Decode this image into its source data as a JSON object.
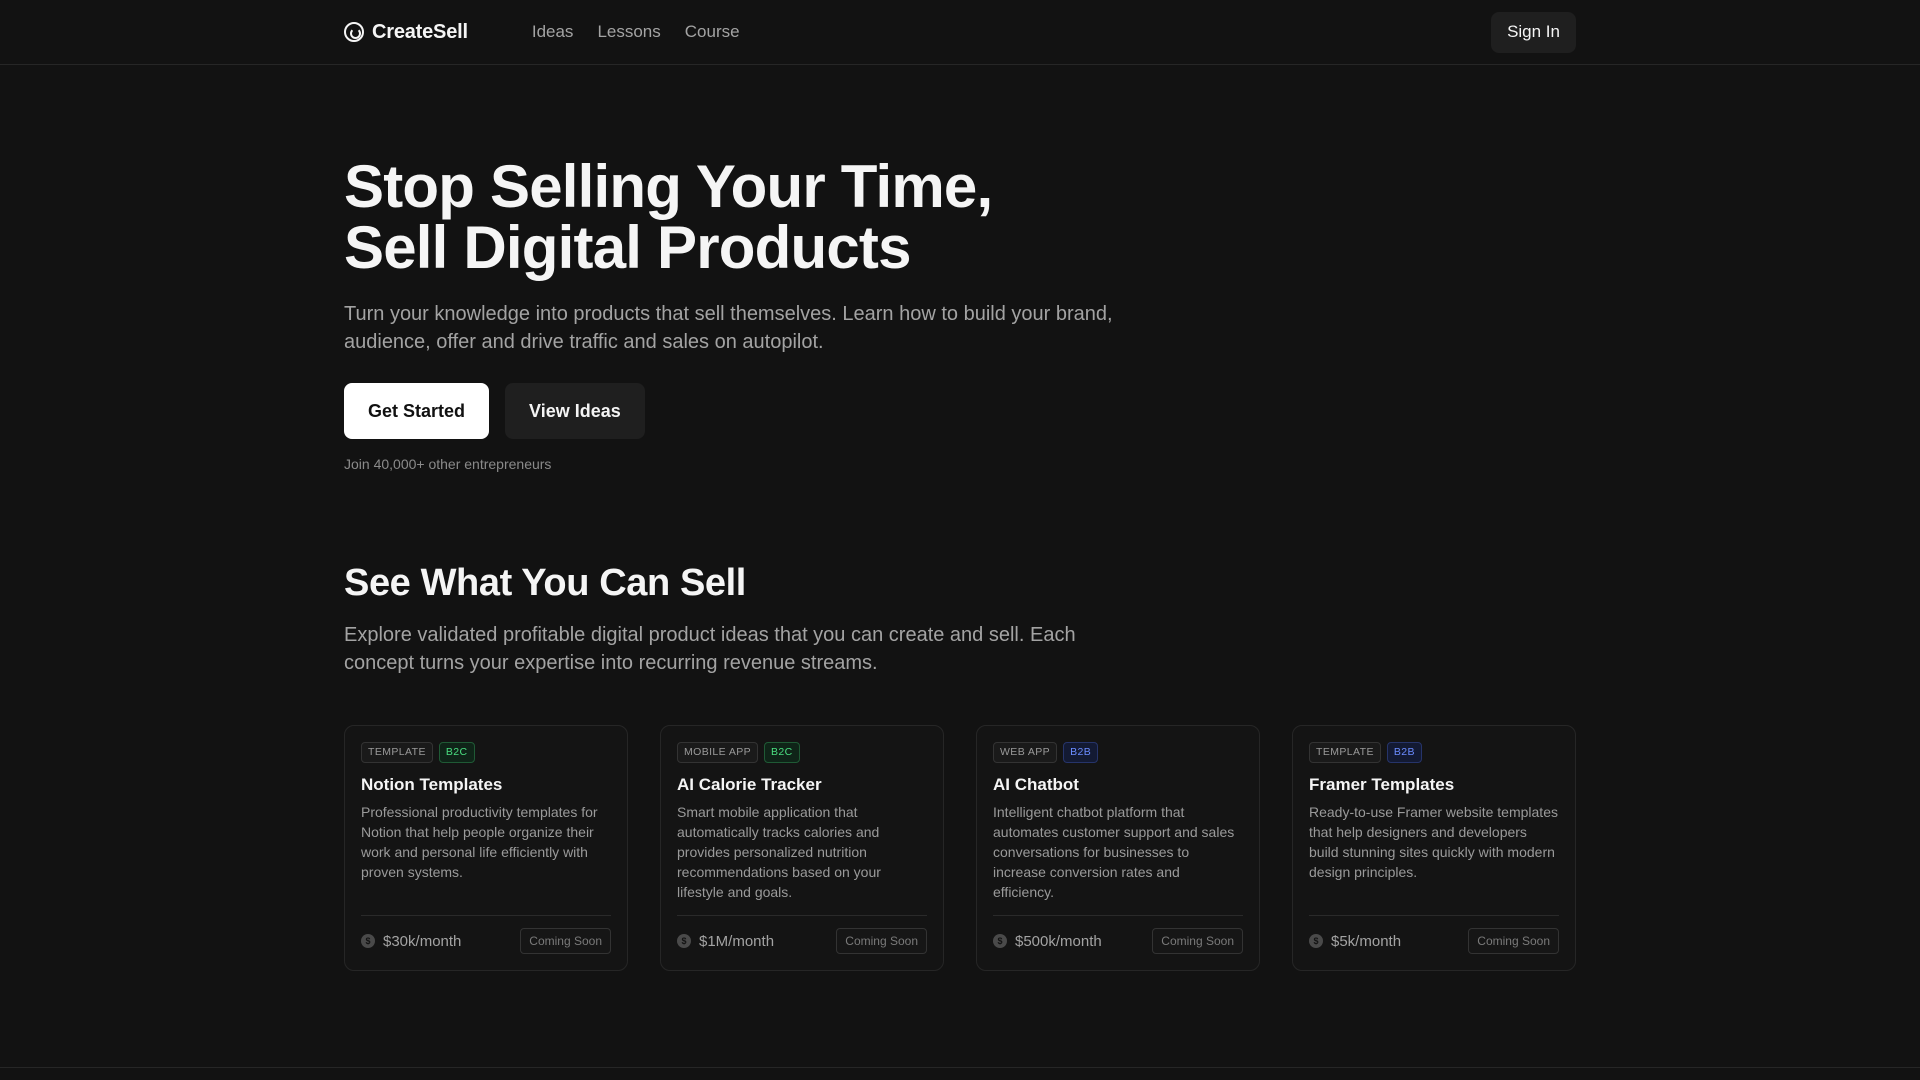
{
  "nav": {
    "brand": "CreateSell",
    "links": [
      "Ideas",
      "Lessons",
      "Course"
    ],
    "signin": "Sign In"
  },
  "hero": {
    "title_line1": "Stop Selling Your Time,",
    "title_line2": "Sell Digital Products",
    "subtitle": "Turn your knowledge into products that sell themselves. Learn how to build your brand, audience, offer and drive traffic and sales on autopilot.",
    "cta_primary": "Get Started",
    "cta_secondary": "View Ideas",
    "note": "Join 40,000+ other entrepreneurs"
  },
  "section": {
    "title": "See What You Can Sell",
    "subtitle": "Explore validated profitable digital product ideas that you can create and sell. Each concept turns your expertise into recurring revenue streams."
  },
  "cards": [
    {
      "type": "TEMPLATE",
      "market": "B2C",
      "title": "Notion Templates",
      "desc": "Professional productivity templates for Notion that help people organize their work and personal life efficiently with proven systems.",
      "revenue": "$30k/month",
      "status": "Coming Soon"
    },
    {
      "type": "MOBILE APP",
      "market": "B2C",
      "title": "AI Calorie Tracker",
      "desc": "Smart mobile application that automatically tracks calories and provides personalized nutrition recommendations based on your lifestyle and goals.",
      "revenue": "$1M/month",
      "status": "Coming Soon"
    },
    {
      "type": "WEB APP",
      "market": "B2B",
      "title": "AI Chatbot",
      "desc": "Intelligent chatbot platform that automates customer support and sales conversations for businesses to increase conversion rates and efficiency.",
      "revenue": "$500k/month",
      "status": "Coming Soon"
    },
    {
      "type": "TEMPLATE",
      "market": "B2B",
      "title": "Framer Templates",
      "desc": "Ready-to-use Framer website templates that help designers and developers build stunning sites quickly with modern design principles.",
      "revenue": "$5k/month",
      "status": "Coming Soon"
    }
  ],
  "icons": {
    "brand": "createsell-logo-icon",
    "revenue": "dollar-coin-icon"
  },
  "colors": {
    "background": "#121212",
    "b2c": "#4ade80",
    "b2b": "#6b8cff"
  }
}
